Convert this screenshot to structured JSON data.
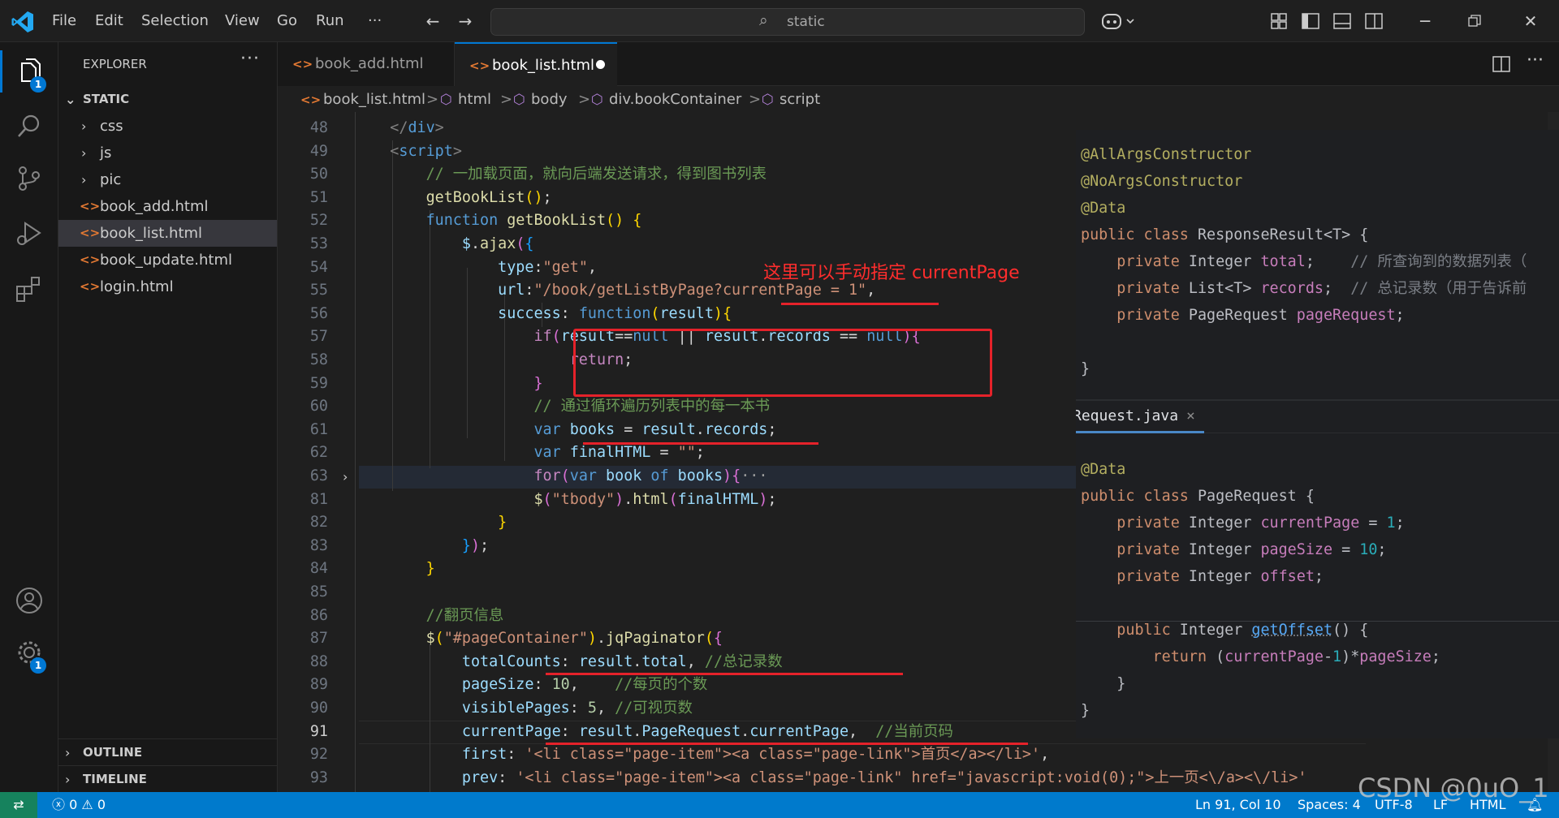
{
  "menu": {
    "file": "File",
    "edit": "Edit",
    "selection": "Selection",
    "view": "View",
    "go": "Go",
    "run": "Run",
    "more": "···"
  },
  "command_center": {
    "label": "static"
  },
  "activity": {
    "explorer_badge": "1",
    "settings_badge": "1"
  },
  "sidebar": {
    "title": "EXPLORER",
    "more": "···",
    "root": "STATIC",
    "items": [
      {
        "label": "css",
        "type": "folder"
      },
      {
        "label": "js",
        "type": "folder"
      },
      {
        "label": "pic",
        "type": "folder"
      },
      {
        "label": "book_add.html",
        "type": "file",
        "icon": "<>"
      },
      {
        "label": "book_list.html",
        "type": "file",
        "icon": "<>",
        "selected": true
      },
      {
        "label": "book_update.html",
        "type": "file",
        "icon": "<>"
      },
      {
        "label": "login.html",
        "type": "file",
        "icon": "<>"
      }
    ],
    "outline": "OUTLINE",
    "timeline": "TIMELINE"
  },
  "tabs": [
    {
      "label": "book_add.html",
      "icon": "<>",
      "active": false
    },
    {
      "label": "book_list.html",
      "icon": "<>",
      "active": true,
      "dirty": true
    }
  ],
  "breadcrumb": {
    "file": "book_list.html",
    "html": "html",
    "body": "body",
    "div": "div.bookContainer",
    "script": "script",
    "file_icon": "<>",
    "sep": ">"
  },
  "editor": {
    "current_line": "91",
    "line_numbers": [
      "48",
      "49",
      "50",
      "51",
      "52",
      "53",
      "54",
      "55",
      "56",
      "57",
      "58",
      "59",
      "60",
      "61",
      "62",
      "63",
      "81",
      "82",
      "83",
      "84",
      "85",
      "86",
      "87",
      "88",
      "89",
      "90",
      "91",
      "92",
      "93"
    ],
    "annotation": "这里可以手动指定 currentPage",
    "comments": {
      "load": "// 一加载页面，就向后端发送请求，得到图书列表",
      "loop": "// 通过循环遍历列表中的每一本书",
      "paging": "//翻页信息",
      "total": "//总记录数",
      "size": "//每页的个数",
      "visible": "//可视页数",
      "current": "//当前页码"
    },
    "strings": {
      "get": "\"get\"",
      "url": "\"/book/getListByPage?currentPage = 1\"",
      "empty": "\"\"",
      "tbody": "\"tbody\"",
      "pager": "\"#pageContainer\"",
      "first": "'<li class=\"page-item\"><a class=\"page-link\">首页</a></li>'",
      "prev": "'<li class=\"page-item\"><a class=\"page-link\" href=\"javascript:void(0);\">上一页<\\/a><\\/li>'"
    },
    "numbers": {
      "one": "1",
      "ten": "10",
      "five": "5"
    },
    "fold_ellipsis": "···"
  },
  "java": {
    "tab_label": "Request.java",
    "tab_close": "×",
    "annotations": [
      "@AllArgsConstructor",
      "@NoArgsConstructor",
      "@Data"
    ],
    "response_class": "ResponseResult<T>",
    "total_comment": "// 所查询到的数据列表（",
    "records_comment": "// 总记录数（用于告诉前",
    "page_request_class": "PageRequest",
    "fields": {
      "total": "total",
      "records": "records",
      "pageRequest": "pageRequest",
      "currentPage": "currentPage",
      "pageSize": "pageSize",
      "offset": "offset"
    },
    "numbers": {
      "one": "1",
      "ten": "10"
    },
    "method": "getOffset"
  },
  "status": {
    "errors": "0",
    "warnings": "0",
    "position": "Ln 91, Col 10",
    "spaces": "Spaces: 4",
    "encoding": "UTF-8",
    "eol": "LF",
    "language": "HTML",
    "watermark": "CSDN @0uO_1"
  },
  "colors": {
    "accent": "#0078d4",
    "status_bar": "#007acc",
    "annotation_red": "#e5222a"
  }
}
